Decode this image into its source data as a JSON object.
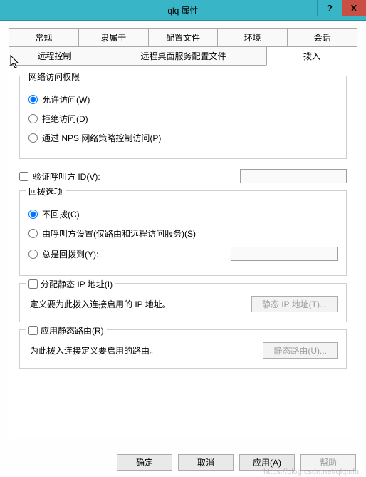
{
  "titlebar": {
    "title": "qlq 属性",
    "help_symbol": "?",
    "close_symbol": "X"
  },
  "tabs": {
    "row1": [
      "常规",
      "隶属于",
      "配置文件",
      "环境",
      "会话"
    ],
    "row2": {
      "remote_ctl": "远程控制",
      "rdp_profile": "远程桌面服务配置文件",
      "dialin": "拨入"
    },
    "active": "拨入"
  },
  "net_access": {
    "legend": "网络访问权限",
    "allow": "允许访问(W)",
    "deny": "拒绝访问(D)",
    "nps": "通过 NPS 网络策略控制访问(P)",
    "selected": "allow"
  },
  "verify_caller": {
    "label": "验证呼叫方 ID(V):",
    "checked": false,
    "value": ""
  },
  "callback": {
    "legend": "回拨选项",
    "none": "不回拨(C)",
    "by_caller": "由呼叫方设置(仅路由和远程访问服务)(S)",
    "always_label": "总是回拨到(Y):",
    "always_value": "",
    "selected": "none"
  },
  "static_ip": {
    "legend": "分配静态 IP 地址(I)",
    "checked": false,
    "desc": "定义要为此拨入连接启用的 IP 地址。",
    "button": "静态 IP 地址(T)..."
  },
  "static_routes": {
    "legend": "应用静态路由(R)",
    "checked": false,
    "desc": "为此拨入连接定义要启用的路由。",
    "button": "静态路由(U)..."
  },
  "buttons": {
    "ok": "确定",
    "cancel": "取消",
    "apply": "应用(A)",
    "help": "帮助"
  },
  "watermark": "https://blog.csdn.net/qlqtulu"
}
